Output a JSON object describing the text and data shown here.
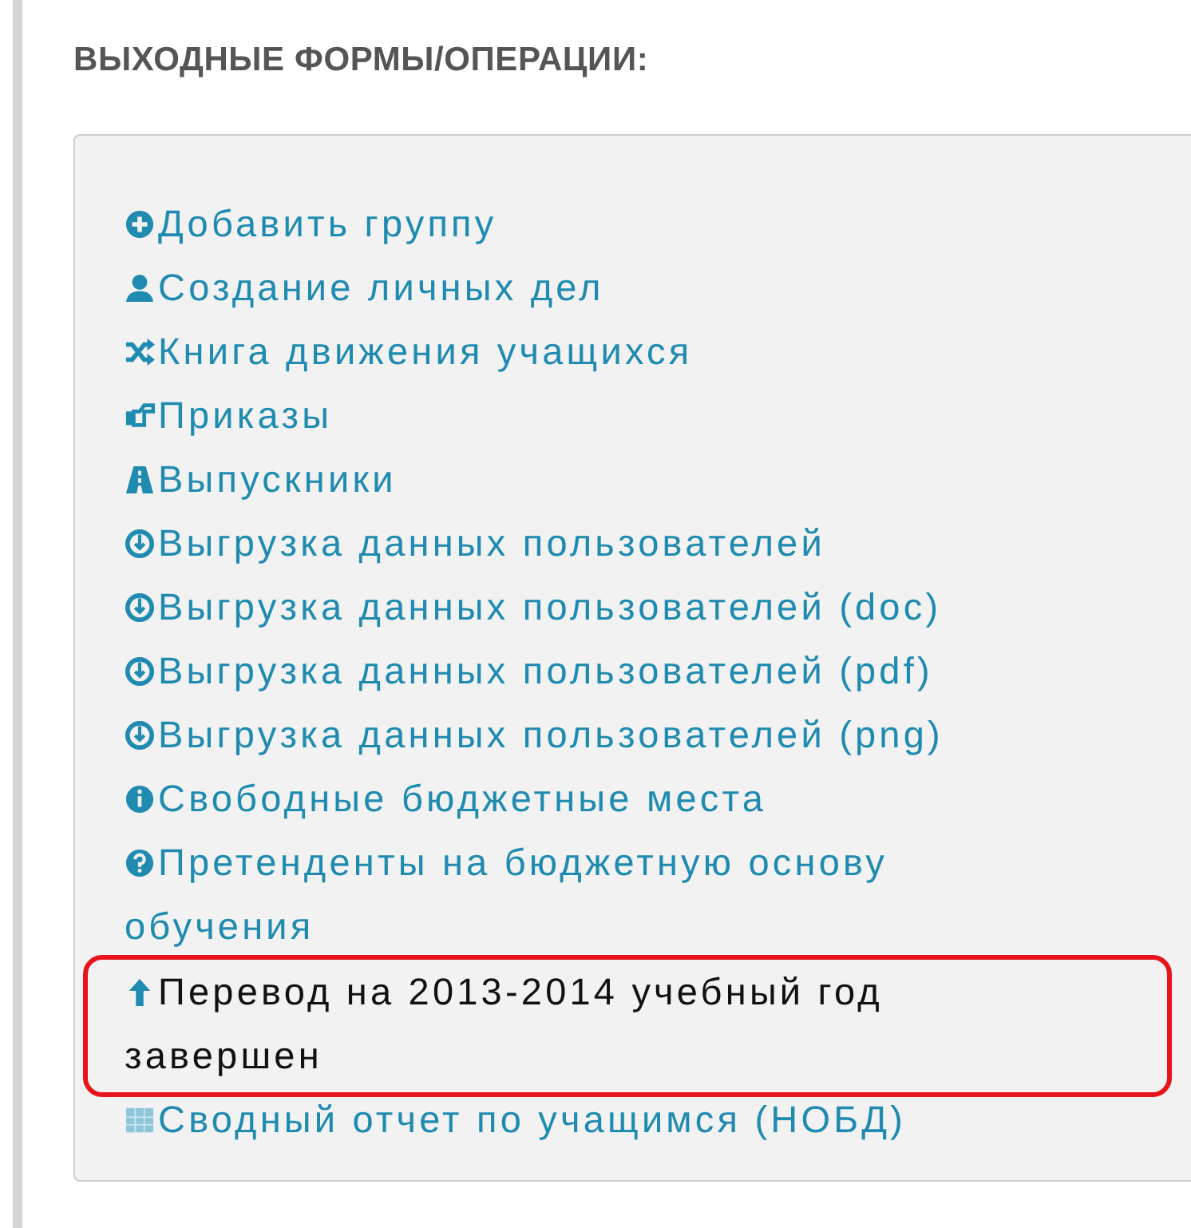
{
  "heading": "ВЫХОДНЫЕ ФОРМЫ/ОПЕРАЦИИ:",
  "items": [
    {
      "label": "Добавить группу",
      "highlighted": false
    },
    {
      "label": "Создание личных дел",
      "highlighted": false
    },
    {
      "label": "Книга движения учащихся",
      "highlighted": false
    },
    {
      "label": "Приказы",
      "highlighted": false
    },
    {
      "label": "Выпускники",
      "highlighted": false
    },
    {
      "label": "Выгрузка данных пользователей",
      "highlighted": false
    },
    {
      "label": "Выгрузка данных пользователей (doc)",
      "highlighted": false
    },
    {
      "label": "Выгрузка данных пользователей (pdf)",
      "highlighted": false
    },
    {
      "label": "Выгрузка данных пользователей (png)",
      "highlighted": false
    },
    {
      "label": "Свободные бюджетные места",
      "highlighted": false
    },
    {
      "label": "Претенденты на бюджетную основу обучения",
      "highlighted": false
    },
    {
      "label": "Перевод на 2013-2014 учебный год завершен",
      "highlighted": true
    },
    {
      "label": "Сводный отчет по учащимся (НОБД)",
      "highlighted": false
    }
  ]
}
